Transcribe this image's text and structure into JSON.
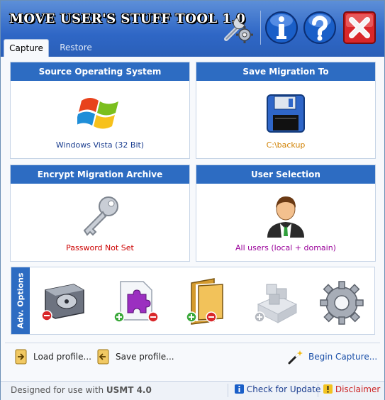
{
  "app": {
    "title": "MOVE USER'S STUFF TOOL 1.0",
    "tabs": [
      {
        "label": "Capture",
        "active": true
      },
      {
        "label": "Restore",
        "active": false
      }
    ]
  },
  "panels": {
    "source": {
      "title": "Source Operating System",
      "value": "Windows Vista (32 Bit)",
      "value_color": "#1a3d8f"
    },
    "save": {
      "title": "Save Migration To",
      "value": "C:\\backup",
      "value_color": "#d08000"
    },
    "encrypt": {
      "title": "Encrypt Migration Archive",
      "value": "Password Not Set",
      "value_color": "#cc0000"
    },
    "users": {
      "title": "User Selection",
      "value": "All users (local + domain)",
      "value_color": "#990099"
    }
  },
  "adv": {
    "label": "Adv. Options"
  },
  "footer": {
    "load": "Load profile...",
    "save": "Save profile...",
    "begin": "Begin Capture..."
  },
  "status": {
    "designed_prefix": "Designed for use with ",
    "designed_bold": "USMT 4.0",
    "check": "Check for Update",
    "disclaimer": "Disclaimer"
  },
  "colors": {
    "accent": "#2d6cc2",
    "link": "#1a4fa8"
  }
}
